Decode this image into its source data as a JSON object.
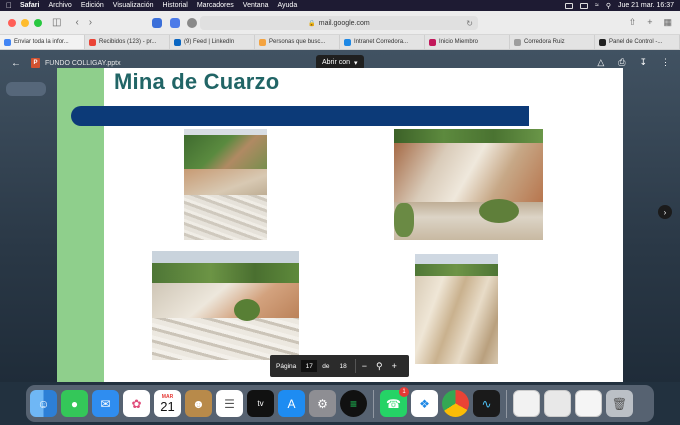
{
  "menubar": {
    "items": [
      "Safari",
      "Archivo",
      "Edición",
      "Visualización",
      "Historial",
      "Marcadores",
      "Ventana",
      "Ayuda"
    ],
    "datetime": "Jue 21 mar.  16:37"
  },
  "toolbar": {
    "url": "mail.google.com"
  },
  "tabs": [
    {
      "label": "Enviar toda la infor...",
      "color": "#4285f4"
    },
    {
      "label": "Recibidos (123) - pr...",
      "color": "#ea4335"
    },
    {
      "label": "(9) Feed | LinkedIn",
      "color": "#0a66c2"
    },
    {
      "label": "Personas que busc...",
      "color": "#f4a340"
    },
    {
      "label": "Intranet Corredora...",
      "color": "#1e88e5"
    },
    {
      "label": "Inicio Miembro",
      "color": "#c2185b"
    },
    {
      "label": "Corredora Ruiz",
      "color": "#9e9e9e"
    },
    {
      "label": "Panel de Control -...",
      "color": "#222222"
    }
  ],
  "viewer": {
    "filename": "FUNDO COLLIGAY.pptx",
    "open_with": "Abrir con"
  },
  "slide": {
    "title": "Mina de Cuarzo"
  },
  "pager": {
    "label": "Página",
    "current": "17",
    "of": "de",
    "total": "18"
  },
  "dock": {
    "calendar_month": "MAR",
    "calendar_day": "21",
    "whatsapp_badge": "1"
  },
  "colors": {
    "slide_green": "#8fcf8c",
    "slide_title": "#216566",
    "slide_bar": "#0c3a78"
  }
}
